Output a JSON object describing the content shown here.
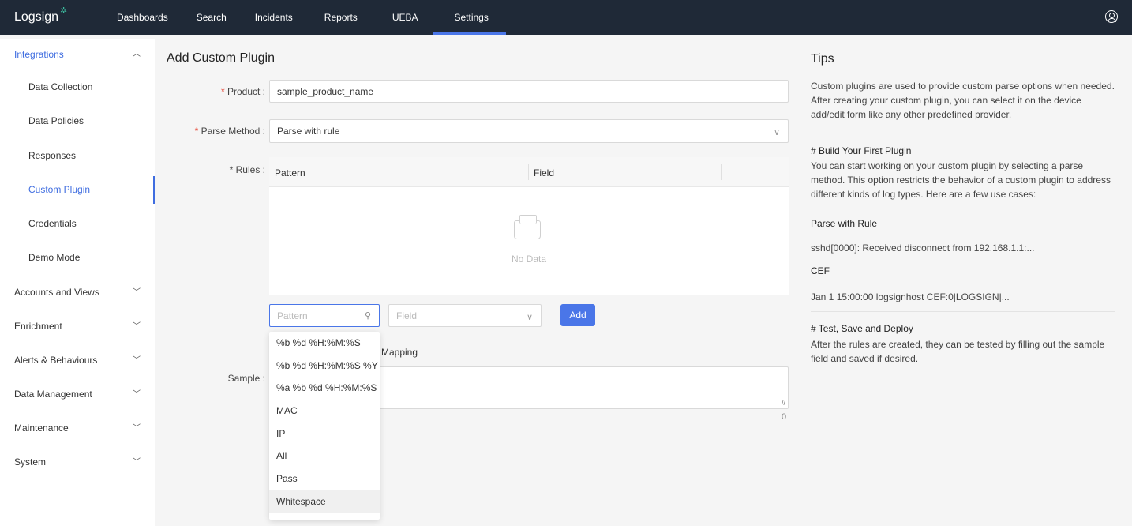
{
  "nav": {
    "logo": "Logsign",
    "items": [
      "Dashboards",
      "Search",
      "Incidents",
      "Reports",
      "UEBA",
      "Settings"
    ],
    "active": "Settings"
  },
  "sidebar": {
    "integrations": "Integrations",
    "sub": [
      "Data Collection",
      "Data Policies",
      "Responses",
      "Custom Plugin",
      "Credentials",
      "Demo Mode"
    ],
    "groups": [
      "Accounts and Views",
      "Enrichment",
      "Alerts & Behaviours",
      "Data Management",
      "Maintenance",
      "System"
    ]
  },
  "form": {
    "title": "Add Custom Plugin",
    "product_label": "Product",
    "product_value": "sample_product_name",
    "parse_label": "Parse Method",
    "parse_value": "Parse with rule",
    "rules_label": "* Rules",
    "col_pattern": "Pattern",
    "col_field": "Field",
    "no_data": "No Data",
    "pattern_placeholder": "Pattern",
    "field_placeholder": "Field",
    "add_label": "Add",
    "mapping_text": "Mapping",
    "sample_label": "Sample",
    "counter": "0"
  },
  "dropdown": [
    "%b %d %H:%M:%S",
    "%b %d %H:%M:%S %Y",
    "%a %b %d %H:%M:%S",
    "MAC",
    "IP",
    "All",
    "Pass",
    "Whitespace"
  ],
  "tips": {
    "title": "Tips",
    "intro": "Custom plugins are used to provide custom parse options when needed. After creating your custom plugin, you can select it on the device add/edit form like any other predefined provider.",
    "build_heading": "# Build Your First Plugin",
    "build_text": "You can start working on your custom plugin by selecting a parse method. This option restricts the behavior of a custom plugin to address different kinds of log types. Here are a few use cases:",
    "rule_heading": "Parse with Rule",
    "rule_example": "sshd[0000]: Received disconnect from 192.168.1.1:...",
    "cef_heading": "CEF",
    "cef_example": "Jan 1 15:00:00 logsignhost CEF:0|LOGSIGN|...",
    "test_heading": "# Test, Save and Deploy",
    "test_text": "After the rules are created, they can be tested by filling out the sample field and saved if desired."
  }
}
